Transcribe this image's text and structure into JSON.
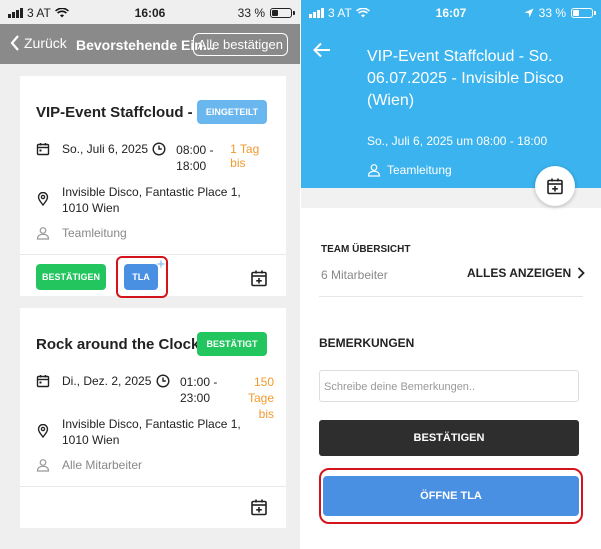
{
  "left": {
    "status": {
      "carrier": "3 AT",
      "time": "16:06",
      "battery": "33 %"
    },
    "nav": {
      "back_label": "Zurück",
      "title": "Bevorstehende Ein...",
      "confirm_all_label": "Alle bestätigen"
    },
    "cards": [
      {
        "title": "VIP-Event Staffcloud - S...",
        "badge": "EINGETEILT",
        "badge_color": "#6ab7f0",
        "date": "So., Juli 6, 2025",
        "time_start": "08:00 -",
        "time_end": "18:00",
        "countdown": "1 Tag bis",
        "address_line1": "Invisible Disco, Fantastic Place 1,",
        "address_line2": "1010  Wien",
        "role": "Teamleitung",
        "confirm_label": "BESTÄTIGEN",
        "tla_label": "TLA"
      },
      {
        "title": "Rock around the Clock -...",
        "badge": "BESTÄTIGT",
        "badge_color": "#22c55e",
        "date": "Di., Dez. 2, 2025",
        "time_start": "01:00 -",
        "time_end": "23:00",
        "countdown_line1": "150",
        "countdown_line2": "Tage bis",
        "address_line1": "Invisible Disco, Fantastic Place 1,",
        "address_line2": "1010  Wien",
        "role": "Alle Mitarbeiter"
      }
    ]
  },
  "right": {
    "status": {
      "carrier": "3 AT",
      "time": "16:07",
      "battery": "33 %"
    },
    "event": {
      "title_line1": "VIP-Event Staffcloud - So.",
      "title_line2": "06.07.2025 - Invisible Disco",
      "title_line3": "(Wien)",
      "datetime": "So., Juli 6, 2025 um 08:00 - 18:00",
      "role": "Teamleitung"
    },
    "team": {
      "heading": "TEAM ÜBERSICHT",
      "count": "6 Mitarbeiter",
      "show_all": "ALLES ANZEIGEN"
    },
    "remarks": {
      "heading": "BEMERKUNGEN",
      "placeholder": "Schreibe deine Bemerkungen.."
    },
    "buttons": {
      "confirm": "BESTÄTIGEN",
      "open_tla": "ÖFFNE TLA"
    },
    "colors": {
      "header": "#3bb3ee",
      "accent": "#4a90e2",
      "dark": "#2e2e2e",
      "highlight": "#d4141b"
    }
  }
}
